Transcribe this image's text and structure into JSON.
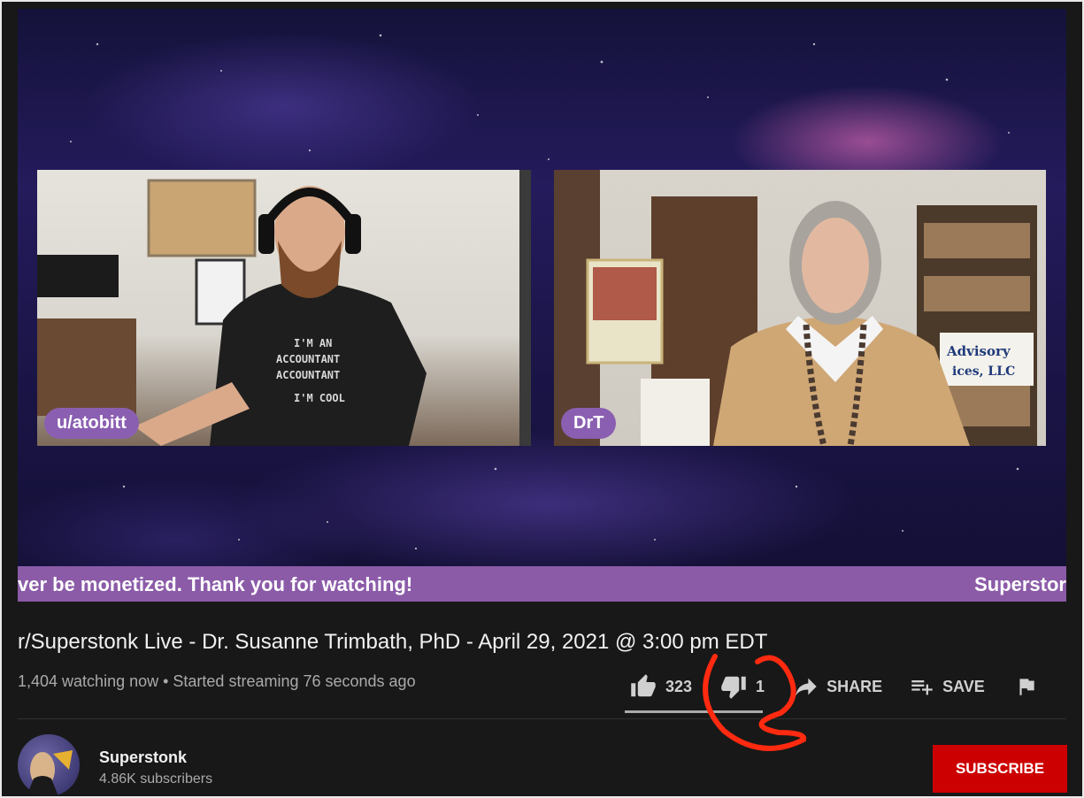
{
  "video": {
    "left_cam_label": "u/atobitt",
    "right_cam_label": "DrT",
    "banner_left": "ver be monetized. Thank you for watching!",
    "banner_right": "Superstor"
  },
  "info": {
    "title": "r/Superstonk Live - Dr. Susanne Trimbath, PhD - April 29, 2021 @ 3:00 pm EDT",
    "meta": "1,404 watching now • Started streaming 76 seconds ago"
  },
  "actions": {
    "like_count": "323",
    "dislike_count": "1",
    "share_label": "SHARE",
    "save_label": "SAVE",
    "like_ratio": 0.997
  },
  "channel": {
    "name": "Superstonk",
    "subscribers": "4.86K subscribers",
    "subscribe_label": "SUBSCRIBE"
  },
  "colors": {
    "subscribe": "#cc0000",
    "banner": "#8b5ba8",
    "annotation": "#ff2a10"
  },
  "icons": [
    "thumbs-up-icon",
    "thumbs-down-icon",
    "share-arrow-icon",
    "playlist-add-icon",
    "flag-icon"
  ]
}
